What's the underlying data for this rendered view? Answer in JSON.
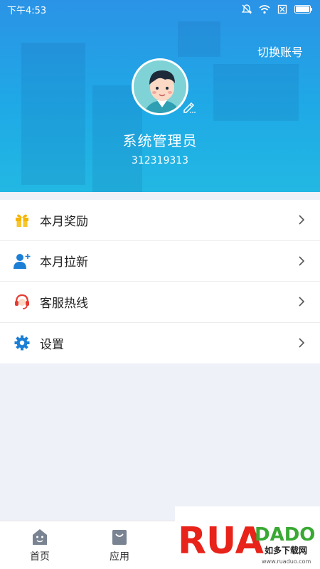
{
  "status_bar": {
    "time": "下午4:53"
  },
  "header": {
    "switch_account": "切换账号",
    "username": "系统管理员",
    "user_id": "312319313"
  },
  "menu": {
    "items": [
      {
        "label": "本月奖励",
        "icon": "gift-icon"
      },
      {
        "label": "本月拉新",
        "icon": "add-user-icon"
      },
      {
        "label": "客服热线",
        "icon": "headset-icon"
      },
      {
        "label": "设置",
        "icon": "gear-icon"
      }
    ]
  },
  "bottom_nav": {
    "items": [
      {
        "label": "首页",
        "icon": "home-icon"
      },
      {
        "label": "应用",
        "icon": "bag-icon"
      }
    ]
  },
  "watermark": {
    "brand": "RUANDADO",
    "cn": "如多下载网",
    "url": "www.ruaduo.com"
  },
  "colors": {
    "header": "#2b93e6",
    "accent": "#1b7fd6",
    "page_bg": "#eef1f8"
  }
}
